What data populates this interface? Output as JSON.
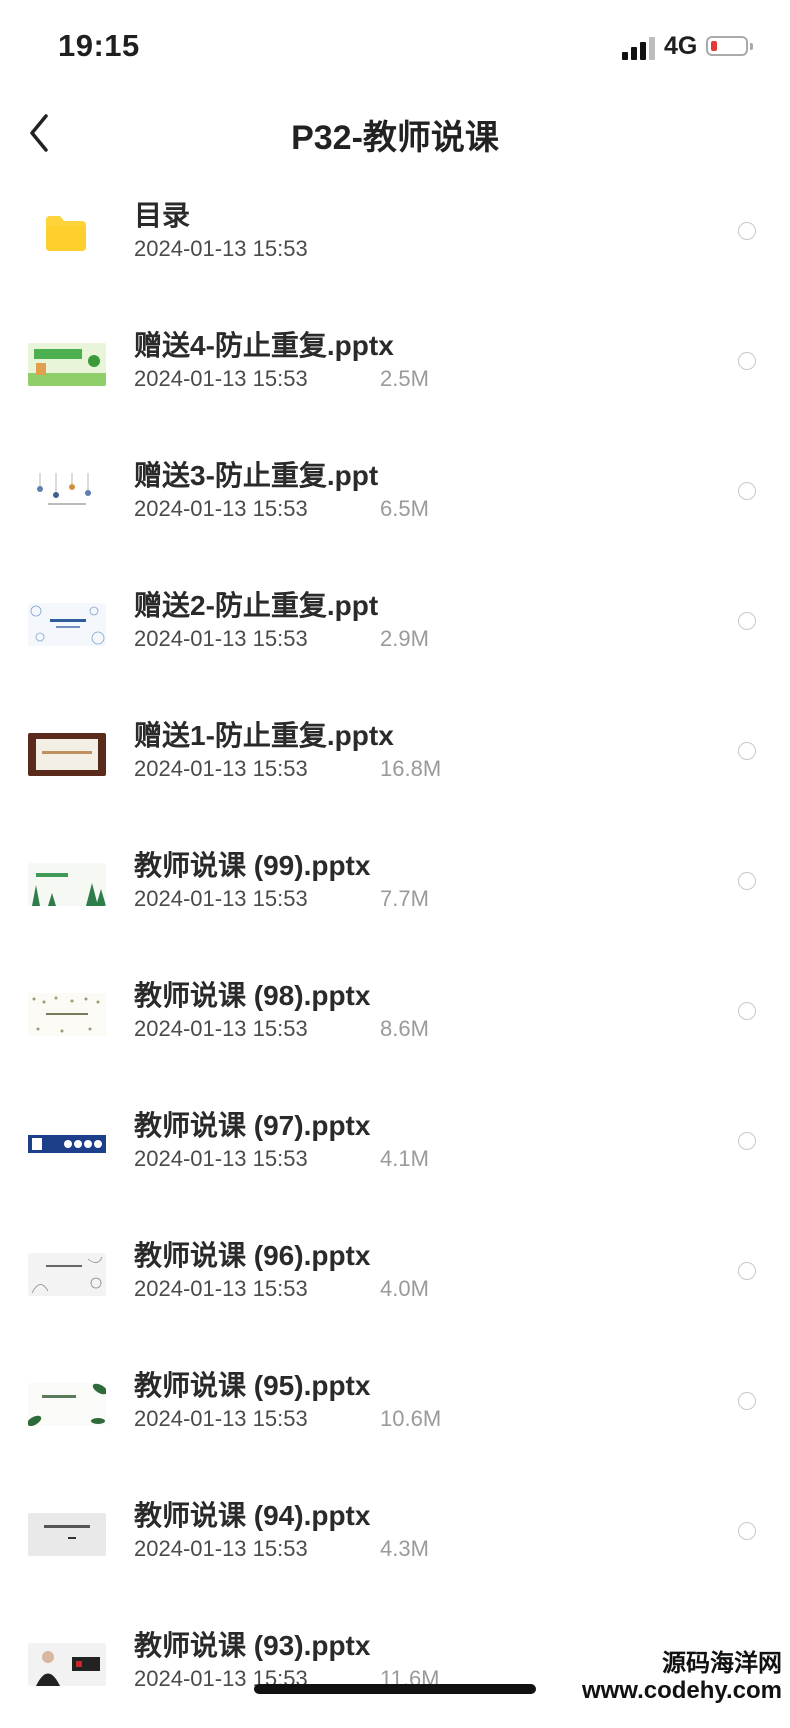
{
  "status": {
    "time": "19:15",
    "network": "4G"
  },
  "nav": {
    "title": "P32-教师说课"
  },
  "files": [
    {
      "name": "目录",
      "date": "2024-01-13 15:53",
      "size": "",
      "type": "folder"
    },
    {
      "name": "赠送4-防止重复.pptx",
      "date": "2024-01-13 15:53",
      "size": "2.5M",
      "type": "thumb-green-ppt"
    },
    {
      "name": "赠送3-防止重复.ppt",
      "date": "2024-01-13 15:53",
      "size": "6.5M",
      "type": "thumb-lamps"
    },
    {
      "name": "赠送2-防止重复.ppt",
      "date": "2024-01-13 15:53",
      "size": "2.9M",
      "type": "thumb-floral-blue"
    },
    {
      "name": "赠送1-防止重复.pptx",
      "date": "2024-01-13 15:53",
      "size": "16.8M",
      "type": "thumb-wood-frame"
    },
    {
      "name": "教师说课 (99).pptx",
      "date": "2024-01-13 15:53",
      "size": "7.7M",
      "type": "thumb-plants"
    },
    {
      "name": "教师说课 (98).pptx",
      "date": "2024-01-13 15:53",
      "size": "8.6M",
      "type": "thumb-doodle"
    },
    {
      "name": "教师说课 (97).pptx",
      "date": "2024-01-13 15:53",
      "size": "4.1M",
      "type": "thumb-blue-band"
    },
    {
      "name": "教师说课 (96).pptx",
      "date": "2024-01-13 15:53",
      "size": "4.0M",
      "type": "thumb-grey-sketch"
    },
    {
      "name": "教师说课 (95).pptx",
      "date": "2024-01-13 15:53",
      "size": "10.6M",
      "type": "thumb-leaves"
    },
    {
      "name": "教师说课 (94).pptx",
      "date": "2024-01-13 15:53",
      "size": "4.3M",
      "type": "thumb-grey-plain"
    },
    {
      "name": "教师说课 (93).pptx",
      "date": "2024-01-13 15:53",
      "size": "11.6M",
      "type": "thumb-person"
    }
  ],
  "watermark": {
    "line1": "源码海洋网",
    "line2": "www.codehy.com"
  }
}
